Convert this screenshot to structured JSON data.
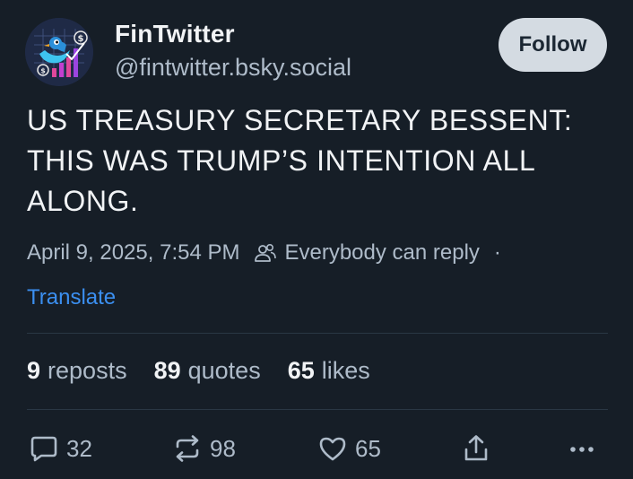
{
  "author": {
    "display_name": "FinTwitter",
    "handle": "@fintwitter.bsky.social",
    "avatar_icon": "bird-with-dollar-chart-avatar"
  },
  "follow_label": "Follow",
  "post": {
    "text": "US TREASURY SECRETARY BESSENT: THIS WAS TRUMP’S INTENTION ALL ALONG.",
    "timestamp": "April 9, 2025, 7:54 PM",
    "reply_setting": "Everybody can reply",
    "separator": "·",
    "translate_label": "Translate"
  },
  "stats": {
    "reposts_count": "9",
    "reposts_label": "reposts",
    "quotes_count": "89",
    "quotes_label": "quotes",
    "likes_count": "65",
    "likes_label": "likes"
  },
  "actions": {
    "reply_count": "32",
    "repost_count": "98",
    "like_count": "65"
  },
  "colors": {
    "background": "#161e27",
    "text_primary": "#f1f3f5",
    "text_secondary": "#aebbc9",
    "link": "#3b8ff0",
    "follow_button_bg": "#d4dbe2"
  }
}
